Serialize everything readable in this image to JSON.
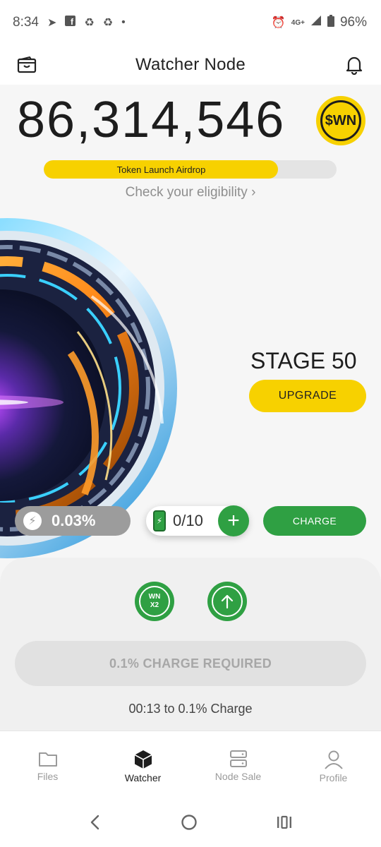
{
  "status_bar": {
    "time": "8:34",
    "network": "4G+",
    "battery": "96%"
  },
  "header": {
    "title": "Watcher Node"
  },
  "balance": {
    "value": "86,314,546",
    "token_symbol": "$WN"
  },
  "airdrop": {
    "label": "Token Launch Airdrop",
    "progress": 0.8,
    "link_text": "Check your eligibility"
  },
  "stage": {
    "label": "STAGE 50",
    "upgrade_label": "UPGRADE"
  },
  "mining": {
    "rate": "0.03%",
    "batteries": "0/10",
    "charge_label": "CHARGE"
  },
  "panel": {
    "boost_line1": "WN",
    "boost_line2": "X2",
    "charge_required": "0.1% CHARGE REQUIRED",
    "countdown": "00:13 to 0.1% Charge"
  },
  "nav": {
    "items": [
      {
        "label": "Files",
        "icon": "folder-icon",
        "active": false
      },
      {
        "label": "Watcher",
        "icon": "cube-icon",
        "active": true
      },
      {
        "label": "Node Sale",
        "icon": "server-icon",
        "active": false
      },
      {
        "label": "Profile",
        "icon": "user-icon",
        "active": false
      }
    ]
  },
  "colors": {
    "accent_yellow": "#f7d100",
    "accent_green": "#2fa043",
    "muted_gray": "#9c9c9c"
  }
}
